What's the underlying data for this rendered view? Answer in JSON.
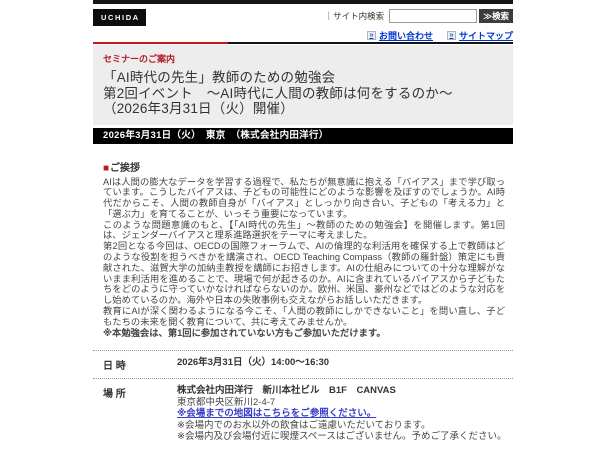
{
  "colors": {
    "accent_red": "#c01920",
    "header_black": "#111111",
    "title_block_bg": "#ededed",
    "top_link_blue": "#0033cc",
    "map_link_blue": "#3a3ec8"
  },
  "header": {
    "logo_text": "UCHIDA",
    "search_label": "｜サイト内検索",
    "search_value": "",
    "search_button": "≫検索",
    "link_bullet": "»",
    "links": [
      {
        "label": "お問い合わせ"
      },
      {
        "label": "サイトマップ"
      }
    ]
  },
  "seminar": {
    "category": "セミナーのご案内",
    "title_lines": [
      "「AI時代の先生」教師のための勉強会",
      "第2回イベント　～AI時代に人間の教師は何をするのか～",
      "（2026年3月31日（火）開催）"
    ],
    "date_bar": "2026年3月31日（火）　東京　（株式会社内田洋行）"
  },
  "greeting": {
    "heading_bullet": "■",
    "heading": "ご挨拶",
    "paragraphs": [
      "AIは人間の膨大なデータを学習する過程で、私たちが無意識に抱える「バイアス」まで学び取っています。こうしたバイアスは、子どもの可能性にどのような影響を及ぼすのでしょうか。AI時代だからこそ、人間の教師自身が「バイアス」としっかり向き合い、子どもの「考える力」と「選ぶ力」を育てることが、いっそう重要になっています。",
      "このような問題意識のもと、【「AI時代の先生」～教師のための勉強会】を開催します。第1回は、ジェンダーバイアスと理系進路選択をテーマに考えました。",
      "第2回となる今回は、OECDの国際フォーラムで、AIの倫理的な利活用を確保する上で教師はどのような役割を担うべきかを講演され、OECD Teaching Compass（教師の羅針盤）策定にも貢献された、滋賀大学の加納圭教授を講師にお招きします。AIの仕組みについての十分な理解がないまま利活用を進めることで、現場で何が起きるのか。AIに含まれているバイアスから子どもたちをどのように守っていかなければならないのか。欧州、米国、豪州などではどのような対応をし始めているのか。海外や日本の失敗事例も交えながらお話しいただきます。",
      "教育にAIが深く関わるようになる今こそ、「人間の教師にしかできないこと」を問い直し、子どもたちの未来を開く教育について、共に考えてみませんか。"
    ],
    "note": "※本勉強会は、第1回に参加されていない方もご参加いただけます。"
  },
  "details": {
    "datetime": {
      "label": "日 時",
      "value": "2026年3月31日（火）14:00～16:30"
    },
    "place": {
      "label": "場 所",
      "name": "株式会社内田洋行　新川本社ビル　B1F　CANVAS",
      "address": "東京都中央区新川2-4-7",
      "map_link": "※会場までの地図はこちらをご参照ください。",
      "notes": [
        "※会場内でのお水以外の飲食はご遠慮いただいております。",
        "※会場内及び会場付近に喫煙スペースはございません。予めご了承ください。"
      ]
    }
  }
}
